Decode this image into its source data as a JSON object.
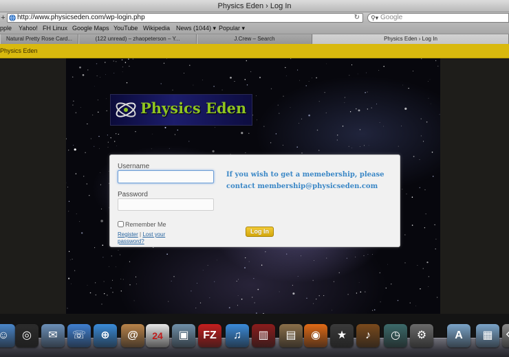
{
  "window": {
    "title": "Physics Eden › Log In"
  },
  "toolbar": {
    "nav_symbol": "+",
    "url": "http://www.physicseden.com/wp-login.php",
    "reload_symbol": "↻",
    "search_placeholder": "Google"
  },
  "bookmarks": [
    "pple",
    "Yahoo!",
    "FH Linux",
    "Google Maps",
    "YouTube",
    "Wikipedia",
    "News (1044) ▾",
    "Popular ▾"
  ],
  "tabs": [
    {
      "label": "Natural Pretty Rose Card...",
      "active": false
    },
    {
      "label": "(122 unread) – zhaopeterson – Y...",
      "active": false
    },
    {
      "label": "J.Crew – Search",
      "active": false
    },
    {
      "label": "Physics Eden › Log In",
      "active": true
    }
  ],
  "page": {
    "site_name": "Physics Eden",
    "logo_text": "Physics Eden",
    "login": {
      "username_label": "Username",
      "username_value": "",
      "password_label": "Password",
      "password_value": "",
      "remember_label": "Remember Me",
      "register_link": "Register",
      "separator": "|",
      "lost_password_link": "Lost your password?",
      "login_button": "Log In",
      "info_text": "If you wish to get a memebership, please contact membership@physicseden.com"
    }
  },
  "colors": {
    "header_yellow": "#d9b90e",
    "info_blue": "#3a87c6",
    "logo_green": "#8fc421",
    "button_gold": "#e2b71f"
  },
  "dock": {
    "icons": [
      {
        "name": "finder-icon",
        "glyph": "☺",
        "color": "#4a86c9"
      },
      {
        "name": "dashboard-icon",
        "glyph": "◎",
        "color": "#2b2b2b"
      },
      {
        "name": "mail-icon",
        "glyph": "✉",
        "color": "#6b8fb8"
      },
      {
        "name": "ichat-icon",
        "glyph": "☏",
        "color": "#3f7fd0"
      },
      {
        "name": "safari-icon",
        "glyph": "⊕",
        "color": "#3a8bd8"
      },
      {
        "name": "address-book-icon",
        "glyph": "@",
        "color": "#b8834a"
      },
      {
        "name": "ical-icon",
        "glyph": "24",
        "color": "#e6e6e6"
      },
      {
        "name": "iphoto-icon",
        "glyph": "▣",
        "color": "#6f8fa8"
      },
      {
        "name": "filezilla-icon",
        "glyph": "FZ",
        "color": "#c41e1e"
      },
      {
        "name": "itunes-icon",
        "glyph": "♫",
        "color": "#3a8ad9"
      },
      {
        "name": "photo-booth-icon",
        "glyph": "▥",
        "color": "#8a1c1c"
      },
      {
        "name": "preview-icon",
        "glyph": "▤",
        "color": "#8a6f4a"
      },
      {
        "name": "firefox-icon",
        "glyph": "◉",
        "color": "#e06a16"
      },
      {
        "name": "imovie-icon",
        "glyph": "★",
        "color": "#3a3a3a"
      },
      {
        "name": "garageband-icon",
        "glyph": "♪",
        "color": "#7a4a1c"
      },
      {
        "name": "time-machine-icon",
        "glyph": "◷",
        "color": "#3c6a6a"
      },
      {
        "name": "system-preferences-icon",
        "glyph": "⚙",
        "color": "#6a6a6a"
      },
      {
        "name": "applications-folder-icon",
        "glyph": "A",
        "color": "#7aa3c8"
      },
      {
        "name": "documents-folder-icon",
        "glyph": "▦",
        "color": "#7aa3c8"
      },
      {
        "name": "trash-icon",
        "glyph": "⌫",
        "color": "#8a8a8a"
      }
    ]
  }
}
